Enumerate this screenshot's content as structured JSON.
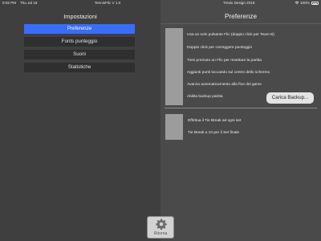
{
  "status_bar": {
    "time": "9:02 PM",
    "date": "Thu Jul 18",
    "app_title": "TennisFlic V 1.0",
    "developer": "Trevix Design 2019",
    "battery": "100%"
  },
  "left_panel": {
    "title": "Impostazioni",
    "menu": [
      {
        "label": "Preferenze",
        "selected": true
      },
      {
        "label": "Fonts punteggio",
        "selected": false
      },
      {
        "label": "Suoni",
        "selected": false
      },
      {
        "label": "Statistiche",
        "selected": false
      }
    ]
  },
  "right_panel": {
    "title": "Preferenze",
    "options_group1": [
      "Usa un solo pulsante Flic (doppio click per Team B)",
      "Doppio click per correggere punteggio",
      "Tieni premuto un Flic per resettare la partita",
      "Aggiunti punti toccando sul centro dello schermo",
      "Avanza automaticamento alla fine del game",
      "Abilita backup partita"
    ],
    "load_backup_label": "Carica Backup...",
    "options_group2": [
      "Effettua il Tie Break ad ogni set",
      "Tie Break a 10 per il Set finale"
    ]
  },
  "footer": {
    "back_label": "Ritorna"
  },
  "colors": {
    "accent": "#3a6df5",
    "left_bg": "#3f3f3f",
    "right_bg": "#4a4a4a"
  },
  "icons": {
    "back": "gear-icon",
    "wifi": "wifi-icon",
    "battery": "battery-icon"
  }
}
